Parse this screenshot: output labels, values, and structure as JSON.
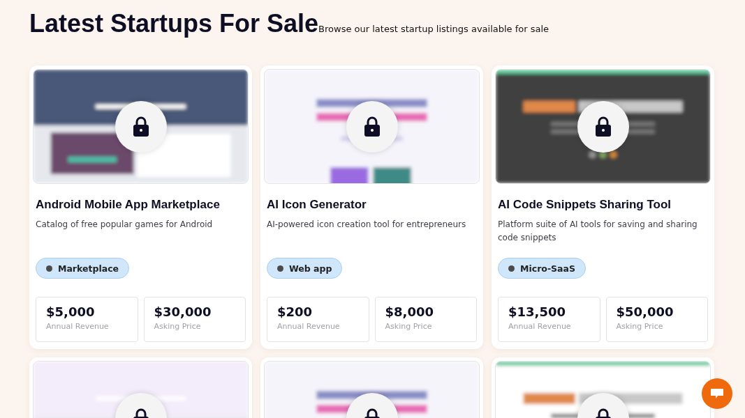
{
  "header": {
    "title": "Latest Startups For Sale",
    "subtitle": "Browse our latest startup listings available for sale"
  },
  "listings": [
    {
      "locked": true,
      "title": "Android Mobile App Marketplace",
      "description": "Catalog of free popular games for Android",
      "tag": "Marketplace",
      "stats": [
        {
          "value": "$5,000",
          "label": "Annual Revenue"
        },
        {
          "value": "$30,000",
          "label": "Asking Price"
        }
      ]
    },
    {
      "locked": true,
      "title": "AI Icon Generator",
      "description": "AI-powered icon creation tool for entrepreneurs",
      "tag": "Web app",
      "stats": [
        {
          "value": "$200",
          "label": "Annual Revenue"
        },
        {
          "value": "$8,000",
          "label": "Asking Price"
        }
      ]
    },
    {
      "locked": true,
      "title": "AI Code Snippets Sharing Tool",
      "description": "Platform suite of AI tools for saving and sharing code snippets",
      "tag": "Micro-SaaS",
      "stats": [
        {
          "value": "$13,500",
          "label": "Annual Revenue"
        },
        {
          "value": "$50,000",
          "label": "Asking Price"
        }
      ]
    },
    {
      "locked": true
    },
    {
      "locked": true
    },
    {
      "locked": true
    }
  ]
}
